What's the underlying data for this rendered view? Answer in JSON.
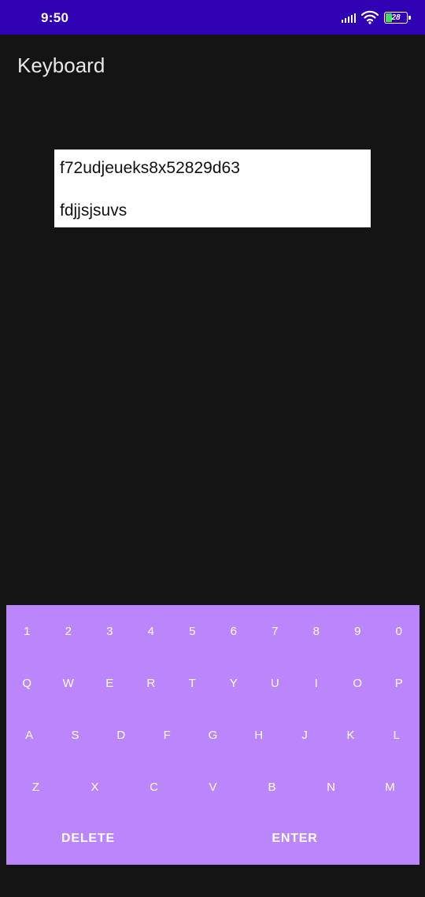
{
  "status_bar": {
    "time": "9:50",
    "battery_level": "28",
    "icons": [
      "signal-icon",
      "wifi-icon",
      "battery-icon"
    ],
    "background": "#3000b3"
  },
  "app": {
    "title": "Keyboard"
  },
  "text_panel": {
    "lines": [
      "f72udjeueks8x52829d63",
      "fdjjsjsuvs"
    ]
  },
  "keyboard": {
    "background": "#bb86fc",
    "rows": [
      [
        "1",
        "2",
        "3",
        "4",
        "5",
        "6",
        "7",
        "8",
        "9",
        "0"
      ],
      [
        "Q",
        "W",
        "E",
        "R",
        "T",
        "Y",
        "U",
        "I",
        "O",
        "P"
      ],
      [
        "A",
        "S",
        "D",
        "F",
        "G",
        "H",
        "J",
        "K",
        "L"
      ],
      [
        "Z",
        "X",
        "C",
        "V",
        "B",
        "N",
        "M"
      ]
    ],
    "delete_label": "DELETE",
    "enter_label": "ENTER"
  }
}
